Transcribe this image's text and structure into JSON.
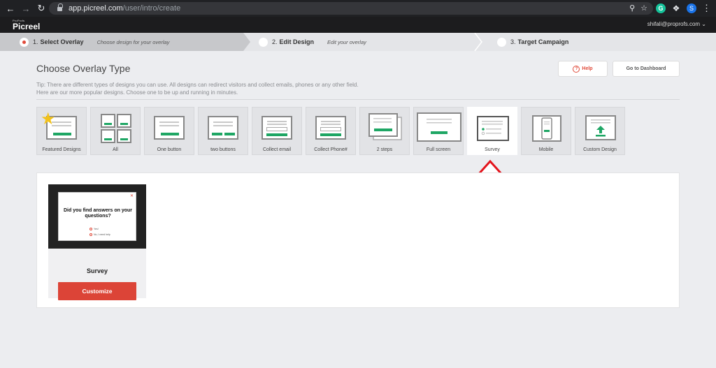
{
  "browser": {
    "url_host": "app.picreel.com",
    "url_path": "/user/intro/create",
    "profile_initial": "S",
    "ext_grammarly": "G"
  },
  "header": {
    "logo_small": "ProProfs",
    "logo": "Picreel",
    "user_email": "shifali@proprofs.com"
  },
  "steps": [
    {
      "num": "1.",
      "title": "Select Overlay",
      "subtitle": "Choose design for your overlay"
    },
    {
      "num": "2.",
      "title": "Edit Design",
      "subtitle": "Edit your overlay"
    },
    {
      "num": "3.",
      "title": "Target Campaign",
      "subtitle": ""
    }
  ],
  "page": {
    "title": "Choose Overlay Type",
    "tip_line1": "Tip: There are different types of designs you can use. All designs can redirect visitors and collect emails, phones or any other field.",
    "tip_line2": "Here are our more popular designs. Choose one to be up and running in minutes.",
    "help_label": "Help",
    "help_icon": "?",
    "dashboard_label": "Go to Dashboard"
  },
  "types": [
    {
      "label": "Featured Designs",
      "icon": "star-icon"
    },
    {
      "label": "All",
      "icon": "grid-icon"
    },
    {
      "label": "One button",
      "icon": "one-button-icon"
    },
    {
      "label": "two buttons",
      "icon": "two-buttons-icon"
    },
    {
      "label": "Collect email",
      "icon": "email-form-icon"
    },
    {
      "label": "Collect Phone#",
      "icon": "phone-form-icon"
    },
    {
      "label": "2 steps",
      "icon": "two-steps-icon"
    },
    {
      "label": "Full screen",
      "icon": "fullscreen-icon"
    },
    {
      "label": "Survey",
      "icon": "survey-icon",
      "selected": true
    },
    {
      "label": "Mobile",
      "icon": "mobile-icon"
    },
    {
      "label": "Custom Design",
      "icon": "upload-icon"
    }
  ],
  "result": {
    "preview_question": "Did you find answers on your questions?",
    "preview_options": [
      "Yes!",
      "No, I need help"
    ],
    "name": "Survey",
    "customize_label": "Customize"
  },
  "colors": {
    "accent_red": "#dc4437",
    "green": "#1ea664",
    "star": "#f2c21b",
    "annotation": "#e3141c"
  }
}
